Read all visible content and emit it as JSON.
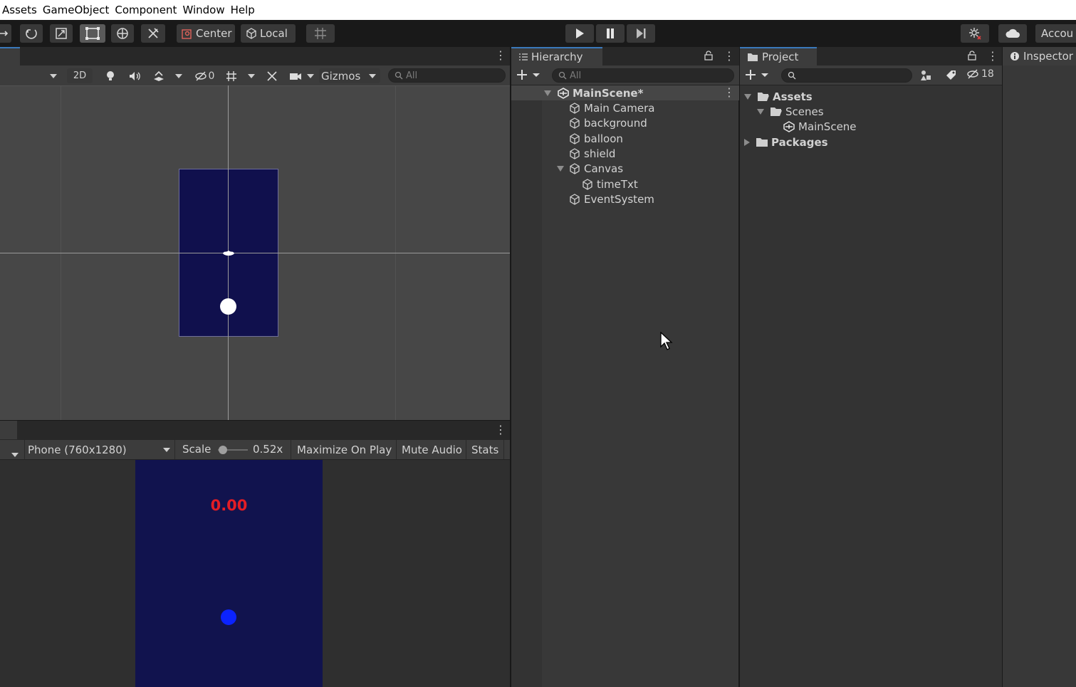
{
  "menubar": {
    "items": [
      "Assets",
      "GameObject",
      "Component",
      "Window",
      "Help"
    ]
  },
  "toolbar": {
    "pivot_label": "Center",
    "space_label": "Local",
    "account_label": "Accou"
  },
  "scene": {
    "mode_2d_label": "2D",
    "hidden_count": "0",
    "gizmos_label": "Gizmos",
    "search_placeholder": "All"
  },
  "game": {
    "resolution": "Phone (760x1280)",
    "scale_label": "Scale",
    "scale_value": "0.52x",
    "maximize_label": "Maximize On Play",
    "mute_label": "Mute Audio",
    "stats_label": "Stats",
    "timer_text": "0.00"
  },
  "hierarchy": {
    "tab_label": "Hierarchy",
    "search_placeholder": "All",
    "scene_name": "MainScene*",
    "objects": [
      "Main Camera",
      "background",
      "balloon",
      "shield",
      "Canvas",
      "timeTxt",
      "EventSystem"
    ]
  },
  "project": {
    "tab_label": "Project",
    "hidden_count": "18",
    "tree": {
      "assets": "Assets",
      "scenes": "Scenes",
      "scene_file": "MainScene",
      "packages": "Packages"
    }
  },
  "inspector": {
    "tab_label": "Inspector"
  },
  "colors": {
    "accent_tab": "#3a79bb",
    "scene_background": "#10104d",
    "timer_color": "#e31d25",
    "ball_game": "#0b23ff"
  }
}
